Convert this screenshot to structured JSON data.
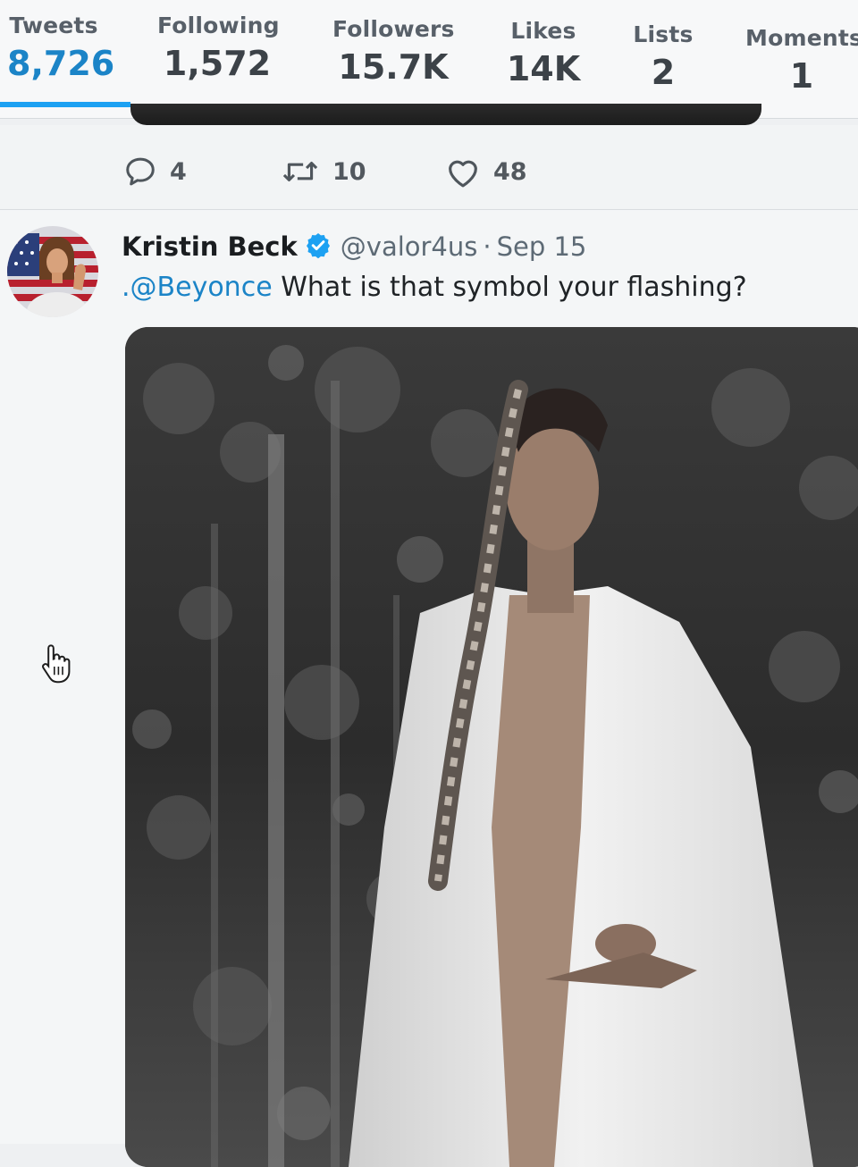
{
  "profile_nav": {
    "stats": [
      {
        "label": "Tweets",
        "value": "8,726",
        "active": true
      },
      {
        "label": "Following",
        "value": "1,572",
        "active": false
      },
      {
        "label": "Followers",
        "value": "15.7K",
        "active": false
      },
      {
        "label": "Likes",
        "value": "14K",
        "active": false
      },
      {
        "label": "Lists",
        "value": "2",
        "active": false
      },
      {
        "label": "Moments",
        "value": "1",
        "active": false
      }
    ]
  },
  "previous_tweet": {
    "actions": {
      "reply_count": "4",
      "retweet_count": "10",
      "like_count": "48"
    }
  },
  "tweet": {
    "author_name": "Kristin Beck",
    "verified": true,
    "author_handle": "@valor4us",
    "separator": "·",
    "date": "Sep 15",
    "mention": ".@Beyonce",
    "text": " What is that symbol your flashing?",
    "media": {
      "type": "photo",
      "tone": "black-and-white"
    }
  },
  "colors": {
    "accent": "#1da1f2",
    "link": "#1b84c7",
    "muted_text": "#5d6a75"
  },
  "icons": [
    "reply-icon",
    "retweet-icon",
    "like-icon",
    "verified-badge-icon",
    "hand-pointer-cursor-icon"
  ]
}
